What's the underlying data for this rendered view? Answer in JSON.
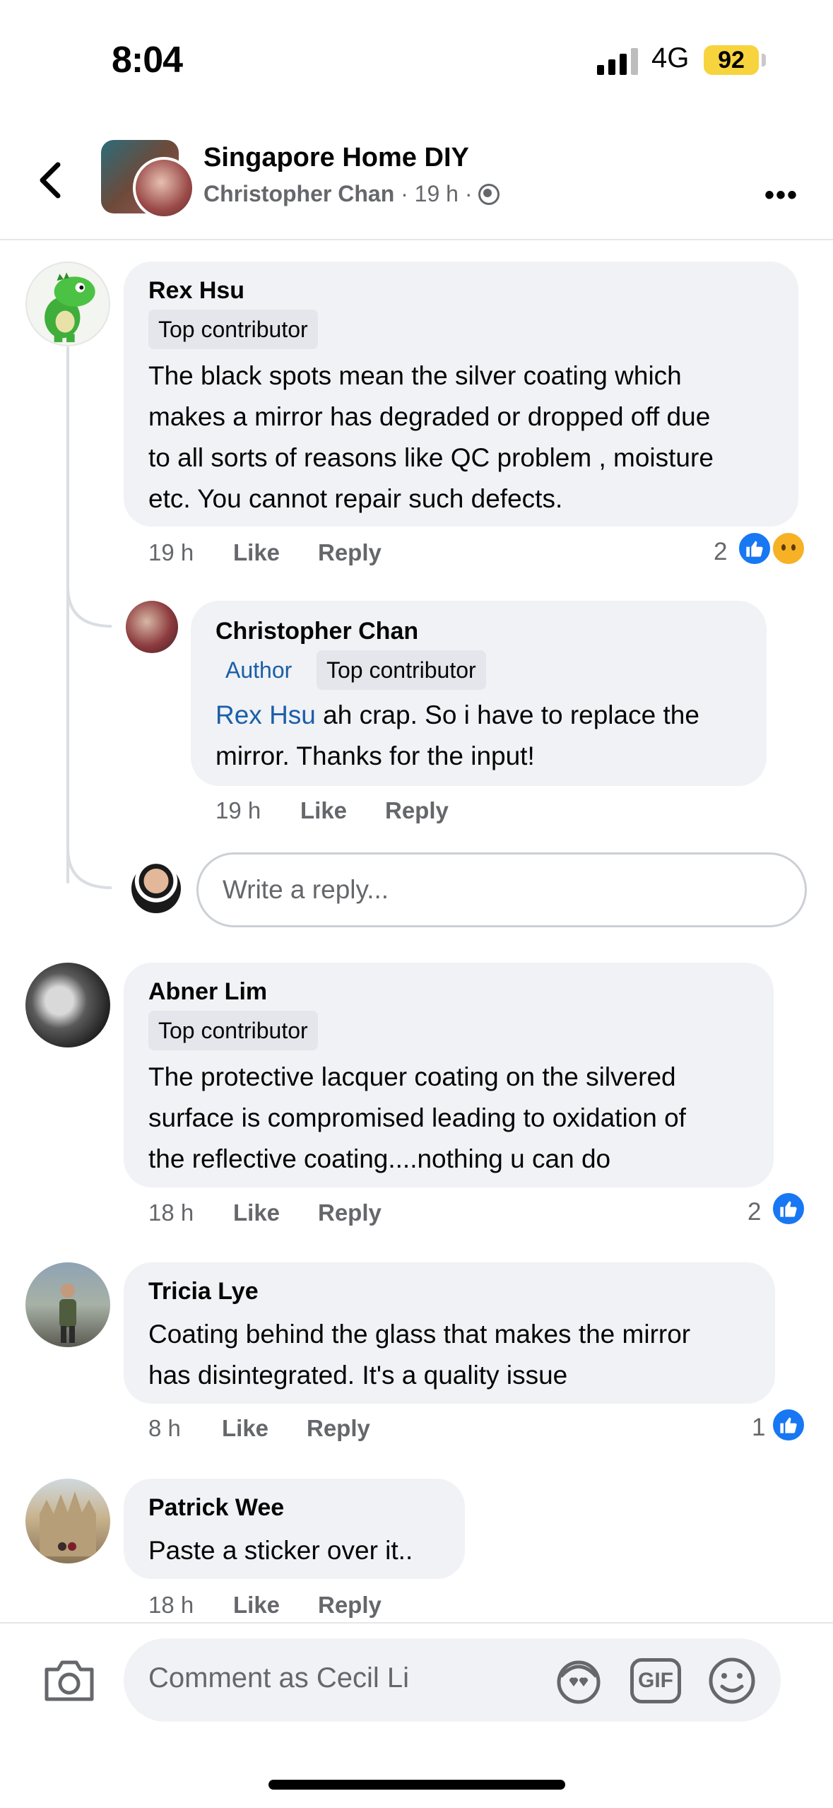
{
  "status_bar": {
    "time": "8:04",
    "network": "4G",
    "battery": "92"
  },
  "header": {
    "group_name": "Singapore Home DIY",
    "author": "Christopher Chan",
    "time": "19 h"
  },
  "comments": [
    {
      "name": "Rex Hsu",
      "badges": [
        "Top contributor"
      ],
      "text_lines": [
        "The black spots mean the silver coating which",
        "makes a mirror has degraded or dropped off due",
        "to all sorts of reasons like QC problem , moisture",
        "etc.  You cannot repair such defects."
      ],
      "time": "19 h",
      "like": "Like",
      "reply": "Reply",
      "reaction_count": "2",
      "reactions": [
        "like-icon",
        "sad-icon"
      ]
    },
    {
      "name": "Christopher Chan",
      "badges": [
        "Author",
        "Top contributor"
      ],
      "mention": "Rex Hsu",
      "text_lines": [
        " ah crap. So i have to replace the",
        "mirror. Thanks for the input!"
      ],
      "time": "19 h",
      "like": "Like",
      "reply": "Reply"
    },
    {
      "name": "Abner Lim",
      "badges": [
        "Top contributor"
      ],
      "text_lines": [
        "The protective lacquer coating on the silvered",
        "surface is compromised leading to oxidation of",
        "the reflective coating....nothing u can do"
      ],
      "time": "18 h",
      "like": "Like",
      "reply": "Reply",
      "reaction_count": "2",
      "reactions": [
        "like-icon"
      ]
    },
    {
      "name": "Tricia Lye",
      "text_lines": [
        "Coating behind the glass that makes the mirror",
        "has disintegrated. It's a quality issue"
      ],
      "time": "8 h",
      "like": "Like",
      "reply": "Reply",
      "reaction_count": "1",
      "reactions": [
        "like-icon"
      ]
    },
    {
      "name": "Patrick Wee",
      "text_lines": [
        "Paste a sticker over it.."
      ],
      "time": "18 h",
      "like": "Like",
      "reply": "Reply"
    }
  ],
  "reply_input": {
    "placeholder": "Write a reply..."
  },
  "composer": {
    "placeholder": "Comment as Cecil Li",
    "gif_label": "GIF"
  },
  "colors": {
    "accent": "#1877f2",
    "link": "#1b5fa8",
    "bubble": "#f0f2f5",
    "battery": "#f7d43d"
  }
}
